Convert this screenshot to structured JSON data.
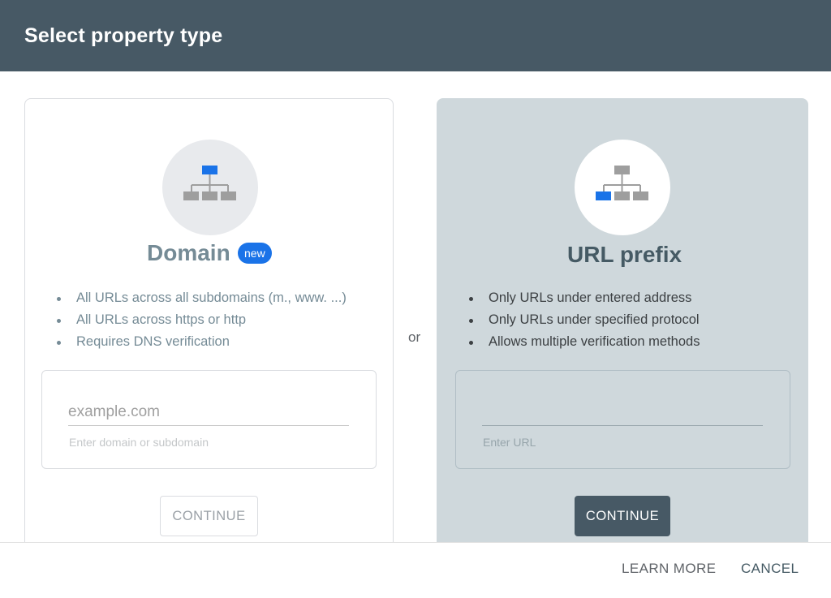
{
  "dialog": {
    "title": "Select property type"
  },
  "domain_card": {
    "icon": "sitemap-icon",
    "title": "Domain",
    "badge": "new",
    "bullets": [
      "All URLs across all subdomains (m., www. ...)",
      "All URLs across https or http",
      "Requires DNS verification"
    ],
    "input": {
      "placeholder": "example.com",
      "value": ""
    },
    "helper": "Enter domain or subdomain",
    "continue_label": "CONTINUE"
  },
  "separator": "or",
  "url_card": {
    "icon": "sitemap-icon",
    "title": "URL prefix",
    "bullets": [
      "Only URLs under entered address",
      "Only URLs under specified protocol",
      "Allows multiple verification methods"
    ],
    "input": {
      "placeholder": "",
      "value": ""
    },
    "helper": "Enter URL",
    "continue_label": "CONTINUE"
  },
  "footer": {
    "learn_more_label": "LEARN MORE",
    "cancel_label": "CANCEL"
  },
  "colors": {
    "header_bg": "#475965",
    "accent_blue": "#1a73e8",
    "selected_card_bg": "#cfd8dc"
  }
}
